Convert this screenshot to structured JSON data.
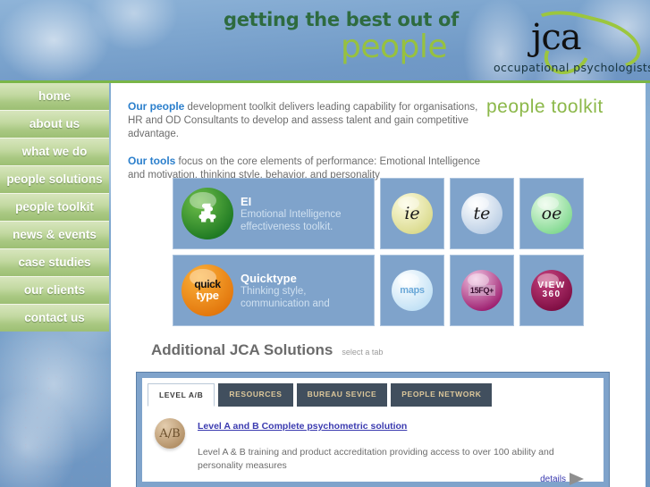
{
  "banner": {
    "tagline_line1": "getting the best out of",
    "tagline_line2": "people",
    "logo_text": "jca",
    "logo_subtitle": "occupational psychologists"
  },
  "sidebar": {
    "items": [
      {
        "label": "home"
      },
      {
        "label": "about us"
      },
      {
        "label": "what we do"
      },
      {
        "label": "people solutions"
      },
      {
        "label": "people toolkit"
      },
      {
        "label": "news & events"
      },
      {
        "label": "case studies"
      },
      {
        "label": "our clients"
      },
      {
        "label": "contact us"
      }
    ]
  },
  "main": {
    "section_title": "people toolkit",
    "intro": {
      "p1_lede": "Our people",
      "p1_rest": " development toolkit delivers leading capability for organisations, HR and OD Consultants to develop and assess talent and gain competitive advantage.",
      "p2_lede": "Our tools",
      "p2_rest": " focus on the core elements of performance: Emotional Intelligence and motivation, thinking style, behavior, and personality"
    },
    "tiles": {
      "row1": {
        "main": {
          "name": "EI",
          "desc_line1": "Emotional Intelligence",
          "desc_line2": "effectiveness toolkit.",
          "badge": "puzzle-icon"
        },
        "small": [
          {
            "badge_text": "ie"
          },
          {
            "badge_text": "te"
          },
          {
            "badge_text": "oe"
          }
        ]
      },
      "row2": {
        "main": {
          "name": "Quicktype",
          "desc_line1": "Thinking style,",
          "desc_line2": "communication and",
          "badge_line1": "quick",
          "badge_line2": "type"
        },
        "small": [
          {
            "badge_text": "maps"
          },
          {
            "badge_text": "15FQ+"
          },
          {
            "badge_line1": "VIEW",
            "badge_line2": "360"
          }
        ]
      }
    },
    "additional": {
      "heading": "Additional JCA Solutions",
      "subheading": "select a tab",
      "tabs": [
        {
          "label": "LEVEL A/B",
          "active": true
        },
        {
          "label": "RESOURCES",
          "active": false
        },
        {
          "label": "BUREAU SEVICE",
          "active": false
        },
        {
          "label": "PEOPLE NETWORK",
          "active": false
        }
      ],
      "panel": {
        "badge_text": "A/B",
        "link": "Level A and B Complete psychometric solution",
        "description": "Level A & B training and product accreditation providing access to over 100 ability and personality measures",
        "details_label": "details"
      }
    }
  },
  "colors": {
    "accent_green": "#7ab648",
    "link_blue": "#2b7fcc",
    "tile_blue": "#7fa3cb",
    "tab_dark": "#414f5e",
    "tab_text": "#dcc79a"
  }
}
